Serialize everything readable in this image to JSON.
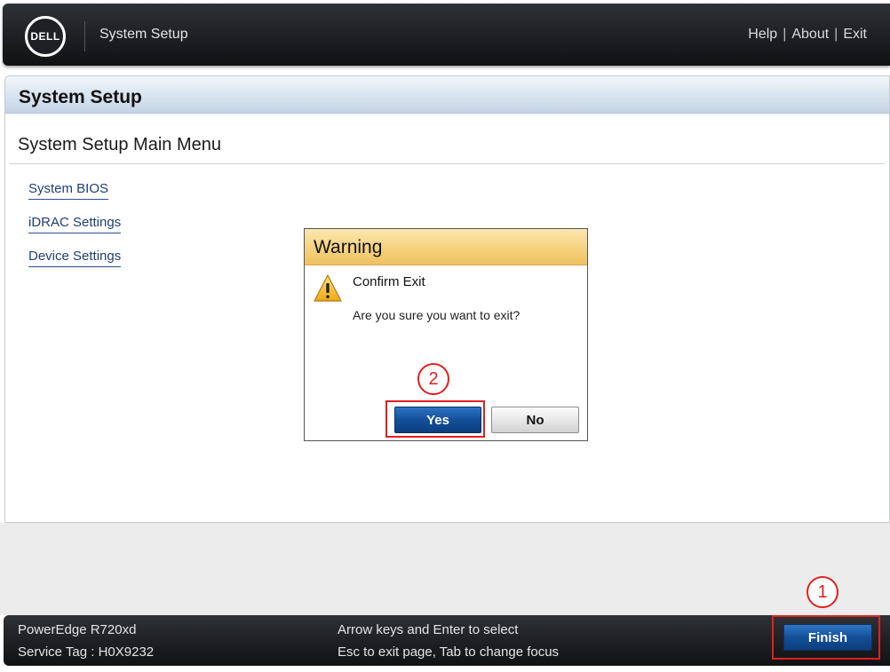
{
  "header": {
    "logo_text": "DELL",
    "title": "System Setup",
    "links": {
      "help": "Help",
      "about": "About",
      "exit": "Exit",
      "separator": "|"
    }
  },
  "panel": {
    "title": "System Setup",
    "menu_title": "System Setup Main Menu",
    "menu_items": [
      "System BIOS",
      "iDRAC Settings",
      "Device Settings"
    ]
  },
  "dialog": {
    "title": "Warning",
    "icon": "warning-triangle-icon",
    "subtitle": "Confirm Exit",
    "message": "Are you sure you want to exit?",
    "yes_label": "Yes",
    "no_label": "No"
  },
  "footer": {
    "model": "PowerEdge R720xd",
    "service_tag": "Service Tag : H0X9232",
    "hint1": "Arrow keys and Enter to select",
    "hint2": "Esc to exit page, Tab to change focus",
    "finish_label": "Finish"
  },
  "annotations": {
    "step1": "1",
    "step2": "2",
    "color": "#e02020"
  },
  "colors": {
    "bar_dark": "#1d1f22",
    "button_blue": "#134f99",
    "dialog_header": "#f6d27f",
    "link_blue": "#1f3f73"
  }
}
